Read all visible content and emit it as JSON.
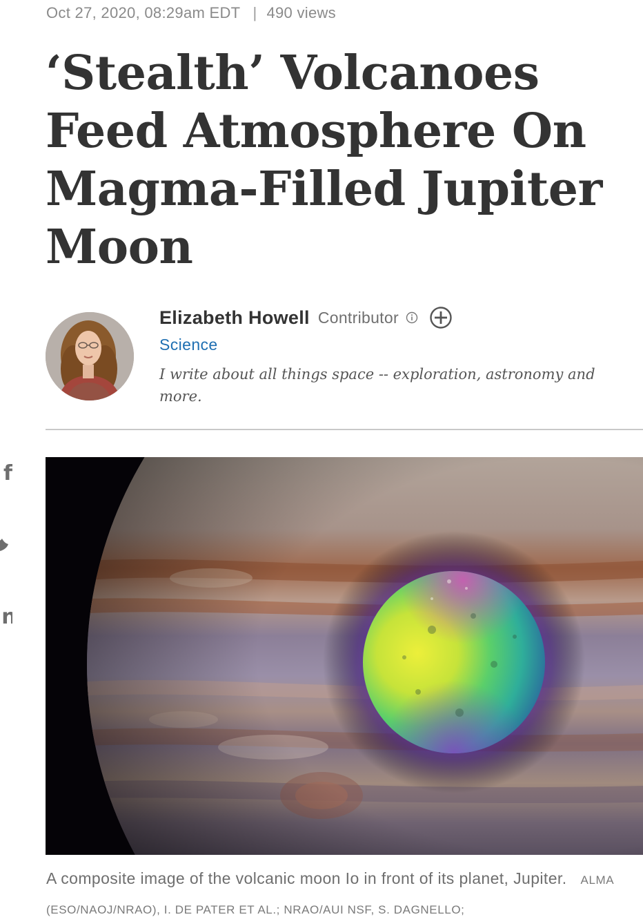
{
  "meta": {
    "date": "Oct 27, 2020, 08:29am EDT",
    "separator": "|",
    "views": "490 views"
  },
  "article": {
    "title": "‘Stealth’ Volcanoes Feed Atmosphere On Magma-Filled Jupiter Moon"
  },
  "author": {
    "name": "Elizabeth Howell",
    "role": "Contributor",
    "section": "Science",
    "bio": "I write about all things space -- exploration, astronomy and more.",
    "icons": {
      "info": "info-icon",
      "follow": "plus-circle-icon"
    }
  },
  "share": {
    "icons": [
      "facebook-icon",
      "twitter-icon",
      "linkedin-icon"
    ],
    "glyphs": {
      "facebook": "f",
      "twitter": "🐦",
      "linkedin": "in"
    }
  },
  "hero": {
    "caption": "A composite image of the volcanic moon Io in front of its planet, Jupiter.",
    "credit": "ALMA (ESO/NAOJ/NRAO), I. DE PATER ET AL.; NRAO/AUI NSF, S. DAGNELLO;"
  },
  "colors": {
    "text": "#333333",
    "muted": "#8a8a8a",
    "link": "#1f6fb2",
    "divider": "#c8c8c8"
  }
}
